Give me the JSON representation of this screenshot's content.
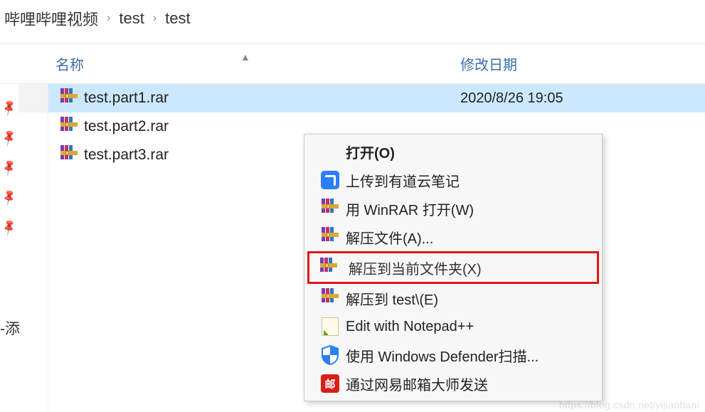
{
  "breadcrumb": {
    "seg0": "哔哩哔哩视频",
    "seg1": "test",
    "seg2": "test",
    "sep": "›"
  },
  "columns": {
    "name": "名称",
    "modified": "修改日期"
  },
  "files": [
    {
      "name": "test.part1.rar",
      "date": "2020/8/26 19:05",
      "selected": true
    },
    {
      "name": "test.part2.rar",
      "date": "",
      "selected": false
    },
    {
      "name": "test.part3.rar",
      "date": "",
      "selected": false
    }
  ],
  "context_menu": {
    "open": "打开(O)",
    "youdao": "上传到有道云笔记",
    "open_winrar": "用 WinRAR 打开(W)",
    "extract_files": "解压文件(A)...",
    "extract_here": "解压到当前文件夹(X)",
    "extract_to_test": "解压到 test\\(E)",
    "edit_npp": "Edit with Notepad++",
    "defender_scan": "使用 Windows Defender扫描...",
    "netease_mail": "通过网易邮箱大师发送",
    "mail_icon_label": "邮"
  },
  "sidebar_label_fragment": "-添",
  "watermark": "https://blog.csdn.net/yijiaobani"
}
